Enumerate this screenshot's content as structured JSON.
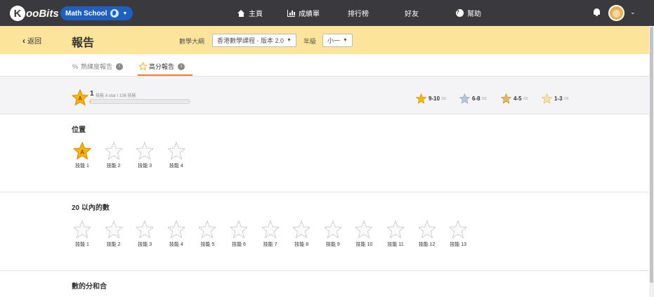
{
  "brand": {
    "logo_k": "K",
    "logo_rest": "ooBits",
    "school": "Math School"
  },
  "nav": {
    "home": "主頁",
    "report": "成績單",
    "leaderboard": "排行榜",
    "friends": "好友",
    "help": "幫助"
  },
  "header": {
    "back": "返回",
    "title": "報告",
    "syllabus_label": "數學大綱",
    "syllabus_value": "香港數學課程 - 版本 2.0",
    "grade_label": "年級",
    "grade_value": "小一"
  },
  "tabs": [
    {
      "label": "熟練度報告"
    },
    {
      "label": "高分報告"
    }
  ],
  "summary": {
    "count": "1",
    "text": "技能 A star / 106 技能",
    "progress_fraction": 0.0094,
    "legend": [
      {
        "label": "9-10",
        "suffix": "/10"
      },
      {
        "label": "6-8",
        "suffix": "/10"
      },
      {
        "label": "4-5",
        "suffix": "/10"
      },
      {
        "label": "1-3",
        "suffix": "/10"
      }
    ]
  },
  "sections": [
    {
      "title": "位置",
      "skills": [
        {
          "label": "技能 1",
          "earned": true,
          "badge": "A"
        },
        {
          "label": "技能 2",
          "earned": false
        },
        {
          "label": "技能 3",
          "earned": false
        },
        {
          "label": "技能 4",
          "earned": false
        }
      ]
    },
    {
      "title": "20 以內的數",
      "skills": [
        {
          "label": "技能 1",
          "earned": false
        },
        {
          "label": "技能 2",
          "earned": false
        },
        {
          "label": "技能 3",
          "earned": false
        },
        {
          "label": "技能 4",
          "earned": false
        },
        {
          "label": "技能 5",
          "earned": false
        },
        {
          "label": "技能 6",
          "earned": false
        },
        {
          "label": "技能 7",
          "earned": false
        },
        {
          "label": "技能 8",
          "earned": false
        },
        {
          "label": "技能 9",
          "earned": false
        },
        {
          "label": "技能 10",
          "earned": false
        },
        {
          "label": "技能 11",
          "earned": false
        },
        {
          "label": "技能 12",
          "earned": false
        },
        {
          "label": "技能 13",
          "earned": false
        }
      ]
    },
    {
      "title": "數的分和合",
      "skills": []
    }
  ],
  "colors": {
    "nav_bg": "#3a3a3e",
    "header_bg": "#fce59a",
    "accent": "#e8823b",
    "gold": "#f5b800",
    "school_pill": "#1f5fbf"
  }
}
